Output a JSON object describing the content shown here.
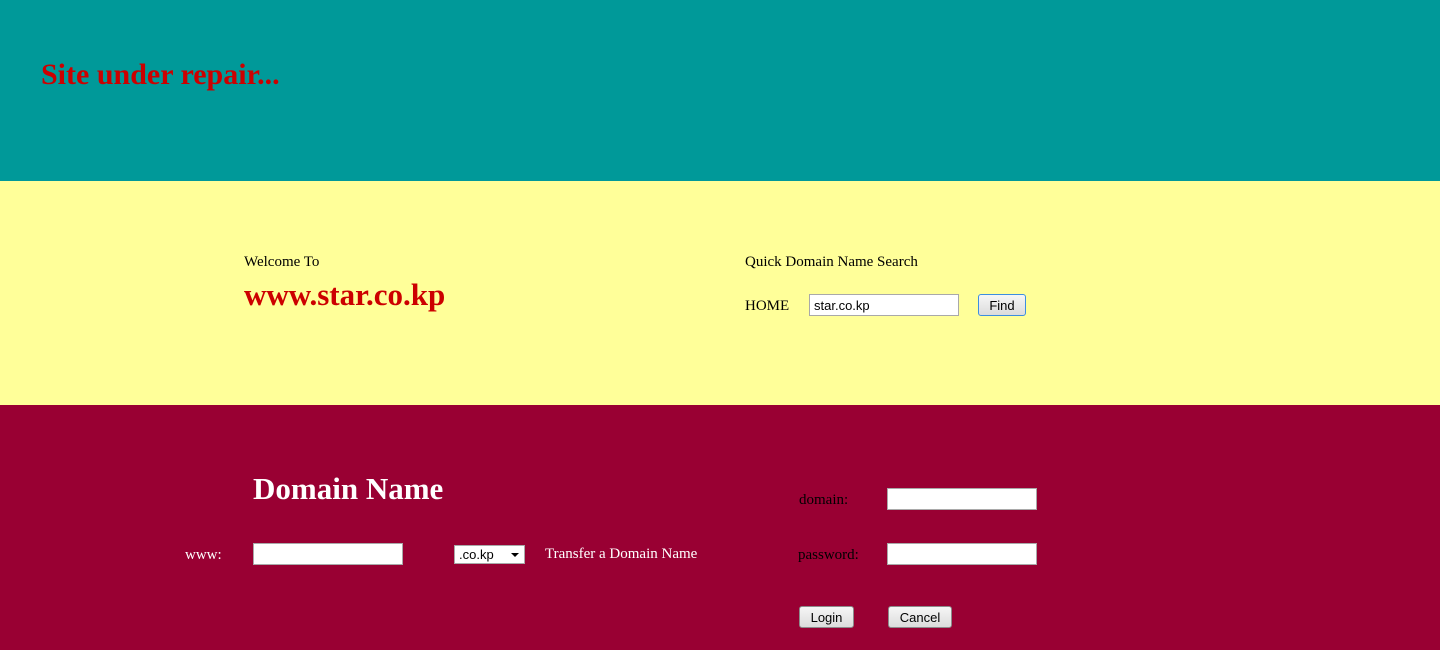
{
  "colors": {
    "header_bg": "#009999",
    "middle_bg": "#ffff99",
    "footer_bg": "#990033",
    "red_text": "#cc0000",
    "white_text": "#ffffff"
  },
  "header": {
    "title": "Site under repair..."
  },
  "welcome": {
    "label": "Welcome To",
    "site_name": "www.star.co.kp"
  },
  "quick_search": {
    "title": "Quick Domain Name Search",
    "label": "HOME",
    "input_value": "star.co.kp",
    "button_label": "Find"
  },
  "domain_name": {
    "title": "Domain Name",
    "prefix_label": "www:",
    "input_value": "",
    "tld_selected": ".co.kp",
    "transfer_link": "Transfer a Domain Name"
  },
  "login": {
    "domain_label": "domain:",
    "password_label": "password:",
    "login_button": "Login",
    "cancel_button": "Cancel"
  }
}
